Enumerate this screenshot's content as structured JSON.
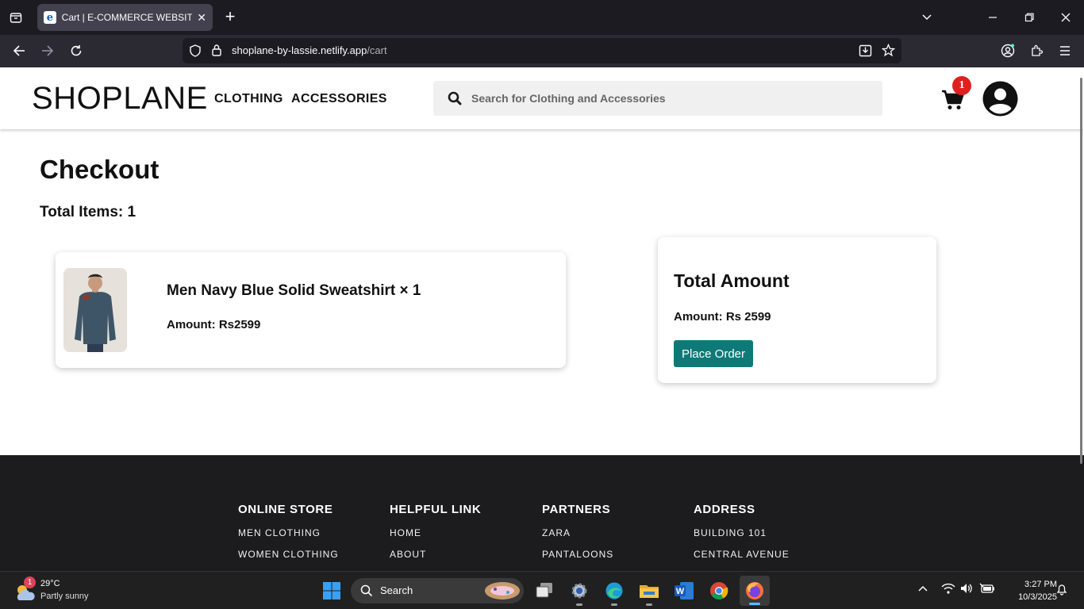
{
  "browser": {
    "tab_title": "Cart | E-COMMERCE WEBSITE BY",
    "tab_close": "✕",
    "new_tab": "+",
    "url_host": "shoplane-by-lassie.netlify.app",
    "url_path": "/cart"
  },
  "header": {
    "logo": "SHOPLANE",
    "nav": [
      "CLOTHING",
      "ACCESSORIES"
    ],
    "search_placeholder": "Search for Clothing and Accessories",
    "cart_count": "1"
  },
  "checkout": {
    "title": "Checkout",
    "total_items": "Total Items: 1",
    "items": [
      {
        "name": "Men Navy Blue Solid Sweatshirt × 1",
        "amount": "Amount: Rs2599"
      }
    ],
    "summary": {
      "title": "Total Amount",
      "amount": "Amount: Rs 2599",
      "button": "Place Order"
    }
  },
  "footer": {
    "columns": [
      {
        "heading": "ONLINE STORE",
        "links": [
          "MEN CLOTHING",
          "WOMEN CLOTHING"
        ]
      },
      {
        "heading": "HELPFUL LINK",
        "links": [
          "HOME",
          "ABOUT"
        ]
      },
      {
        "heading": "PARTNERS",
        "links": [
          "ZARA",
          "PANTALOONS"
        ]
      },
      {
        "heading": "ADDRESS",
        "links": [
          "BUILDING 101",
          "CENTRAL AVENUE"
        ]
      }
    ]
  },
  "taskbar": {
    "weather_temp": "29°C",
    "weather_desc": "Partly sunny",
    "weather_badge": "1",
    "search_label": "Search",
    "time": "3:27 PM",
    "date": "10/3/2025"
  },
  "colors": {
    "accent": "#0e7a78",
    "badge": "#e0201e",
    "footer_bg": "#1c1b1e"
  }
}
